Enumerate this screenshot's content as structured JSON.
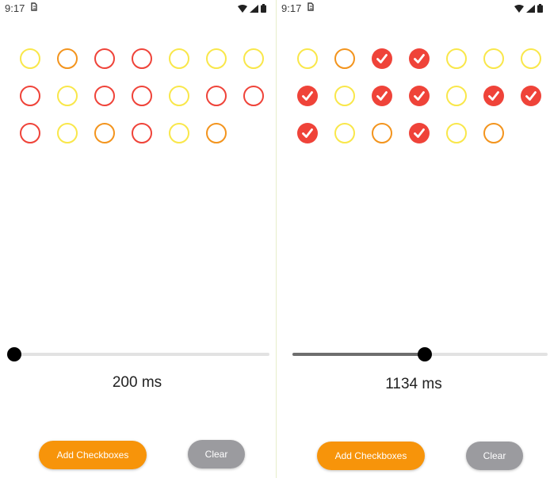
{
  "colors": {
    "yellow": "#f9e74a",
    "orange": "#f3941d",
    "red": "#ef4339"
  },
  "screens": [
    {
      "status": {
        "time": "9:17",
        "sim_icon": "sim-card-icon",
        "wifi_icon": "wifi-icon",
        "signal_icon": "signal-icon",
        "battery_icon": "battery-icon"
      },
      "checkboxes": [
        [
          "yellow",
          "orange",
          "red",
          "red",
          "yellow",
          "yellow",
          "yellow"
        ],
        [
          "red",
          "yellow",
          "red",
          "red",
          "yellow",
          "red",
          "red"
        ],
        [
          "red",
          "yellow",
          "orange",
          "red",
          "yellow",
          "orange"
        ]
      ],
      "checked": [
        [
          false,
          false,
          false,
          false,
          false,
          false,
          false
        ],
        [
          false,
          false,
          false,
          false,
          false,
          false,
          false
        ],
        [
          false,
          false,
          false,
          false,
          false,
          false
        ]
      ],
      "slider": {
        "fraction": 0.0
      },
      "value_text": "200 ms",
      "add_label": "Add Checkboxes",
      "clear_label": "Clear"
    },
    {
      "status": {
        "time": "9:17",
        "sim_icon": "sim-card-icon",
        "wifi_icon": "wifi-icon",
        "signal_icon": "signal-icon",
        "battery_icon": "battery-icon"
      },
      "checkboxes": [
        [
          "yellow",
          "orange",
          "red",
          "red",
          "yellow",
          "yellow",
          "yellow"
        ],
        [
          "red",
          "yellow",
          "red",
          "red",
          "yellow",
          "red",
          "red"
        ],
        [
          "red",
          "yellow",
          "orange",
          "red",
          "yellow",
          "orange"
        ]
      ],
      "checked": [
        [
          false,
          false,
          true,
          true,
          false,
          false,
          false
        ],
        [
          true,
          false,
          true,
          true,
          false,
          true,
          true
        ],
        [
          true,
          false,
          false,
          true,
          false,
          false
        ]
      ],
      "slider": {
        "fraction": 0.52
      },
      "value_text": "1134 ms",
      "add_label": "Add Checkboxes",
      "clear_label": "Clear"
    }
  ]
}
